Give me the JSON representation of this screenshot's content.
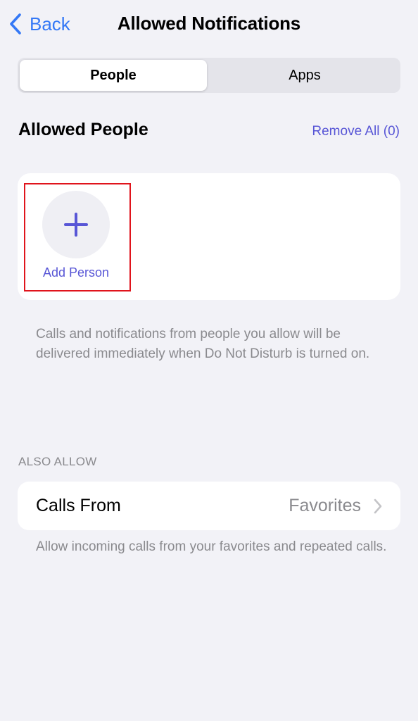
{
  "nav": {
    "back_label": "Back",
    "title": "Allowed Notifications"
  },
  "segmented": {
    "people_label": "People",
    "apps_label": "Apps",
    "selected": "People"
  },
  "allowed_people": {
    "heading": "Allowed People",
    "remove_all_label": "Remove All (0)",
    "add_person_label": "Add Person",
    "footer_note": "Calls and notifications from people you allow will be delivered immediately when Do Not Disturb is turned on."
  },
  "also_allow": {
    "heading": "ALSO ALLOW",
    "calls_from_label": "Calls From",
    "calls_from_value": "Favorites",
    "footer_note": "Allow incoming calls from your favorites and repeated calls."
  },
  "colors": {
    "background": "#f2f2f7",
    "back_blue": "#3478f6",
    "accent_purple": "#5856d6",
    "secondary_text": "#8a8a8e",
    "highlight_red": "#e0141c"
  },
  "icons": {
    "back": "chevron-left-icon",
    "add": "plus-icon",
    "disclosure": "chevron-right-icon"
  }
}
